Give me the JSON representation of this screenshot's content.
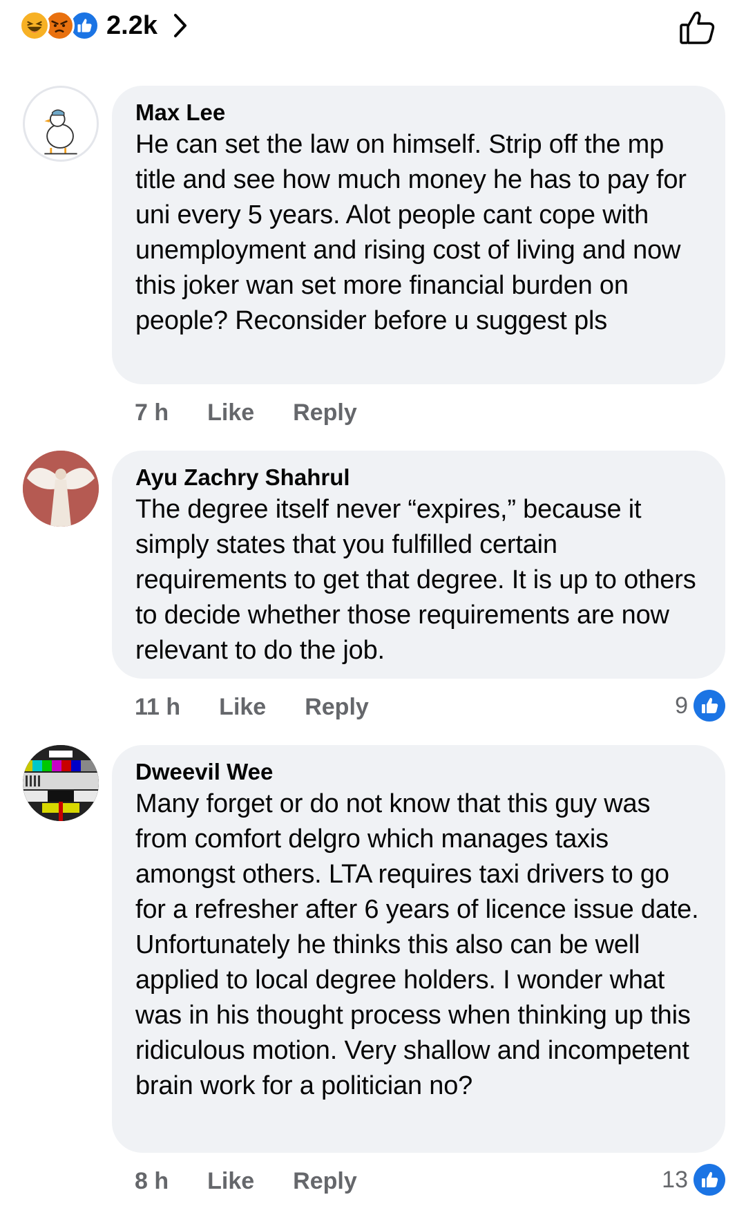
{
  "header": {
    "reaction_icons": [
      "haha-icon",
      "angry-icon",
      "like-icon"
    ],
    "reaction_count": "2.2k"
  },
  "colors": {
    "like_blue": "#1b74e4",
    "haha_yellow": "#f7b125",
    "angry_orange": "#e9710f",
    "bubble_gray": "#f0f2f5",
    "meta_gray": "#65676b"
  },
  "comments": [
    {
      "author": "Max Lee",
      "text": "He can set the law on himself. Strip off the mp title and see how much money he has to pay for uni every 5 years. Alot people cant cope with unemployment and rising cost of living and now this joker wan set more financial burden on people? Reconsider before u suggest pls",
      "time": "7 h",
      "like_label": "Like",
      "reply_label": "Reply",
      "likes": ""
    },
    {
      "author": "Ayu Zachry Shahrul",
      "text": "The degree itself never “expires,” because it simply states that you fulfilled certain requirements to get that degree. It is up to others to decide whether those requirements are now relevant to do the job.",
      "time": "11 h",
      "like_label": "Like",
      "reply_label": "Reply",
      "likes": "9"
    },
    {
      "author": "Dweevil Wee",
      "text": "Many forget or do not know that this guy was from comfort delgro which manages taxis amongst others. LTA requires taxi drivers to go for a refresher after 6 years of licence issue date. Unfortunately he thinks this also can be well applied to local degree holders. I wonder what was in his thought process when thinking up this ridiculous motion. Very shallow and incompetent brain work for a politician no?",
      "time": "8 h",
      "like_label": "Like",
      "reply_label": "Reply",
      "likes": "13"
    }
  ]
}
